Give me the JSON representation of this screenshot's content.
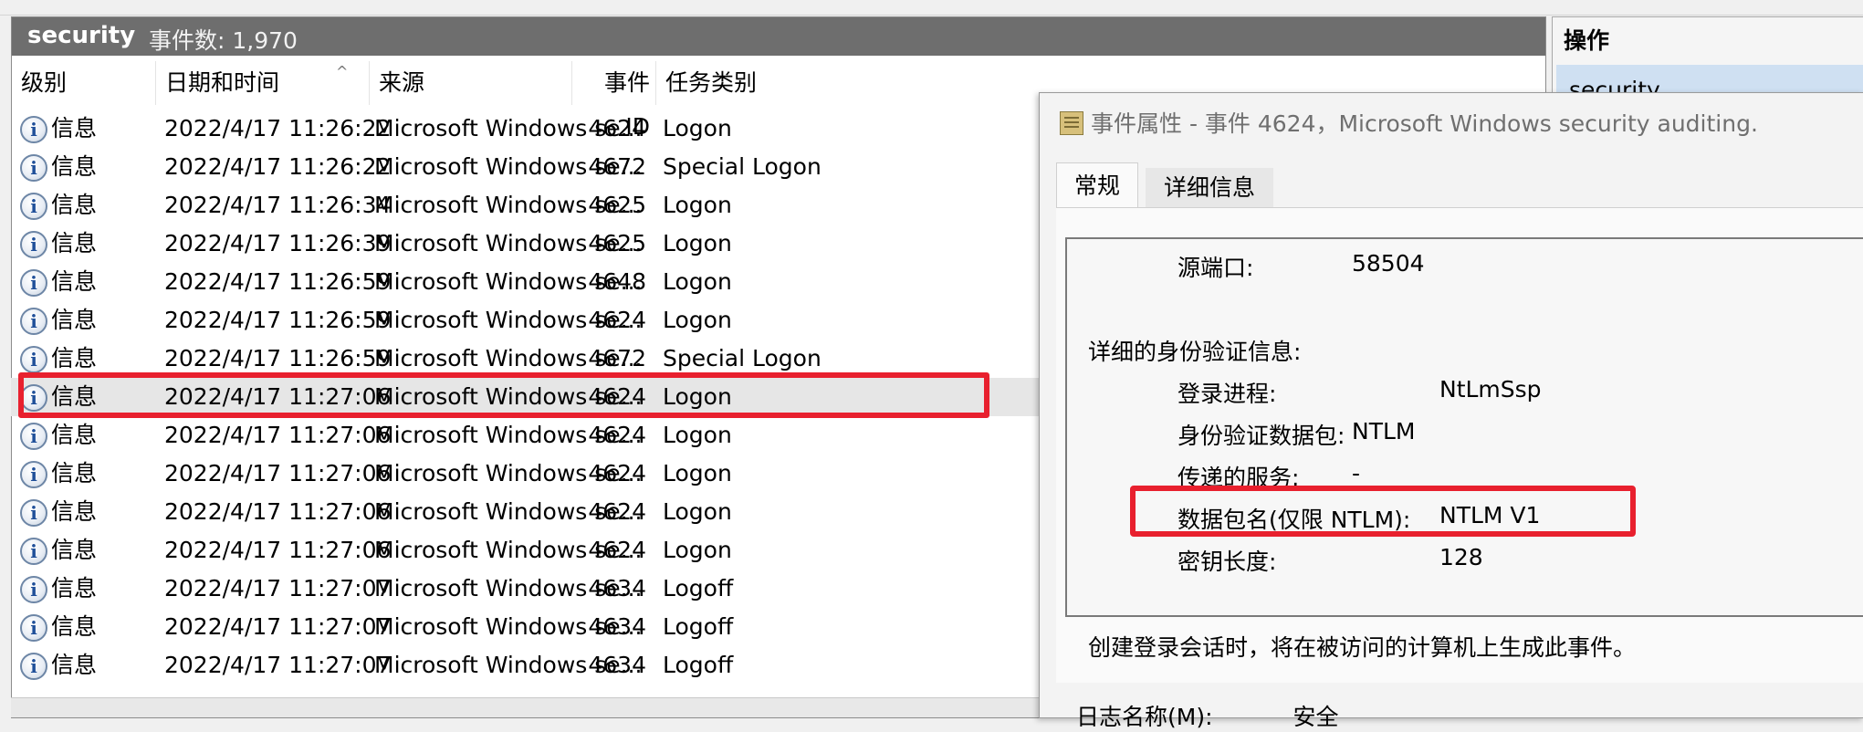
{
  "log": {
    "name": "security",
    "count_label": "事件数: 1,970",
    "columns": [
      "级别",
      "日期和时间",
      "来源",
      "事件 ID",
      "任务类别"
    ],
    "sort_indicator": "^",
    "rows": [
      {
        "level": "信息",
        "datetime": "2022/4/17 11:26:22",
        "source": "Microsoft Windows se...",
        "event_id": "4624",
        "category": "Logon"
      },
      {
        "level": "信息",
        "datetime": "2022/4/17 11:26:22",
        "source": "Microsoft Windows se...",
        "event_id": "4672",
        "category": "Special Logon"
      },
      {
        "level": "信息",
        "datetime": "2022/4/17 11:26:34",
        "source": "Microsoft Windows se...",
        "event_id": "4625",
        "category": "Logon"
      },
      {
        "level": "信息",
        "datetime": "2022/4/17 11:26:39",
        "source": "Microsoft Windows se...",
        "event_id": "4625",
        "category": "Logon"
      },
      {
        "level": "信息",
        "datetime": "2022/4/17 11:26:59",
        "source": "Microsoft Windows se...",
        "event_id": "4648",
        "category": "Logon"
      },
      {
        "level": "信息",
        "datetime": "2022/4/17 11:26:59",
        "source": "Microsoft Windows se...",
        "event_id": "4624",
        "category": "Logon"
      },
      {
        "level": "信息",
        "datetime": "2022/4/17 11:26:59",
        "source": "Microsoft Windows se...",
        "event_id": "4672",
        "category": "Special Logon"
      },
      {
        "level": "信息",
        "datetime": "2022/4/17 11:27:06",
        "source": "Microsoft Windows se...",
        "event_id": "4624",
        "category": "Logon"
      },
      {
        "level": "信息",
        "datetime": "2022/4/17 11:27:06",
        "source": "Microsoft Windows se...",
        "event_id": "4624",
        "category": "Logon"
      },
      {
        "level": "信息",
        "datetime": "2022/4/17 11:27:06",
        "source": "Microsoft Windows se...",
        "event_id": "4624",
        "category": "Logon"
      },
      {
        "level": "信息",
        "datetime": "2022/4/17 11:27:06",
        "source": "Microsoft Windows se...",
        "event_id": "4624",
        "category": "Logon"
      },
      {
        "level": "信息",
        "datetime": "2022/4/17 11:27:06",
        "source": "Microsoft Windows se...",
        "event_id": "4624",
        "category": "Logon"
      },
      {
        "level": "信息",
        "datetime": "2022/4/17 11:27:07",
        "source": "Microsoft Windows se...",
        "event_id": "4634",
        "category": "Logoff"
      },
      {
        "level": "信息",
        "datetime": "2022/4/17 11:27:07",
        "source": "Microsoft Windows se...",
        "event_id": "4634",
        "category": "Logoff"
      },
      {
        "level": "信息",
        "datetime": "2022/4/17 11:27:07",
        "source": "Microsoft Windows se...",
        "event_id": "4634",
        "category": "Logoff"
      }
    ],
    "selected_row_index": 7
  },
  "actions": {
    "title": "操作",
    "item": "security"
  },
  "dialog": {
    "title": "事件属性 - 事件 4624，Microsoft Windows security auditing.",
    "tabs": [
      "常规",
      "详细信息"
    ],
    "source_port_label": "源端口:",
    "source_port_value": "58504",
    "auth_section": "详细的身份验证信息:",
    "logon_process_label": "登录进程:",
    "logon_process_value": "NtLmSsp",
    "auth_package_label": "身份验证数据包:",
    "auth_package_value": "NTLM",
    "transited_label": "传递的服务:",
    "transited_value": "-",
    "package_name_label": "数据包名(仅限 NTLM):",
    "package_name_value": "NTLM V1",
    "key_length_label": "密钥长度:",
    "key_length_value": "128",
    "description": "创建登录会话时，将在被访问的计算机上生成此事件。",
    "bottom_label": "日志名称(M):",
    "bottom_value": "安全"
  },
  "colors": {
    "highlight": "#e8202e",
    "header_bg": "#6e6e6e",
    "selected_action_bg": "#cfe0f2"
  },
  "icons": {
    "level_icon": "info-icon",
    "dialog_icon": "event-properties-icon"
  }
}
